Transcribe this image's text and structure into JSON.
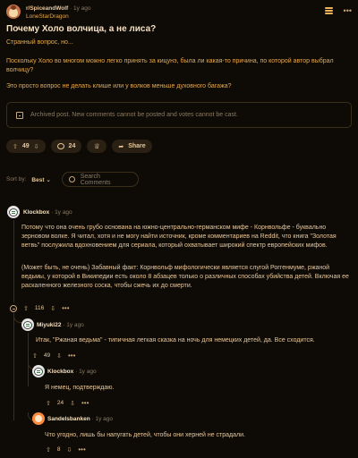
{
  "post": {
    "subreddit": "r/SpiceandWolf",
    "sep": "·",
    "age": "1y ago",
    "author": "LoneStarDragon",
    "title": "Почему Холо волчица, а не лиса?",
    "paragraphs": [
      "Странный вопрос, но...",
      "Поскольку Холо во многом можно легко принять за кицунэ, была ли какая-то причина, по которой автор выбрал волчицу?",
      "Это просто вопрос не делать клише или у волков меньше духовного багажа?"
    ],
    "archived_notice": "Archived post. New comments cannot be posted and votes cannot be cast.",
    "votes": "49",
    "comments": "24",
    "share_label": "Share"
  },
  "sort": {
    "label": "Sort by:",
    "value": "Best",
    "search_placeholder": "Search Comments"
  },
  "comments": [
    {
      "author": "Klockbox",
      "age": "1y ago",
      "paragraphs": [
        "Потому что она очень грубо основана на южно-центрально-германском мифе - Корнвольфе - буквально зерновом волке. Я читал, хотя и не могу найти источник, кроме комментариев на Reddit, что книга \"Золотая ветвь\" послужила вдохновением для сериала, который охватывает широкий спектр европейских мифов.",
        "(Может быть, не очень) Забавный факт: Корнвольф мифологически является слугой Роггенмуме, ржаной ведьмы, у которой в Википедии есть около 8 абзацев только о различных способах убийства детей. Включая ее раскаленного железного соска, чтобы сжечь их до смерти."
      ],
      "votes": "116"
    },
    {
      "author": "Miyuki22",
      "age": "1y ago",
      "paragraphs": [
        "Итак, \"Ржаная ведьма\" - типичная легкая сказка на ночь для немецких детей, да. Все сходится."
      ],
      "votes": "49"
    },
    {
      "author": "Klockbox",
      "age": "1y ago",
      "paragraphs": [
        "Я немец, подтверждаю."
      ],
      "votes": "24"
    },
    {
      "author": "Sandelsbanken",
      "age": "1y ago",
      "paragraphs": [
        "Что угодно, лишь бы напугать детей, чтобы они херней не страдали."
      ],
      "votes": "8"
    }
  ],
  "icons": {
    "upvote": "⇧",
    "downvote": "⇩",
    "more": "•••"
  }
}
